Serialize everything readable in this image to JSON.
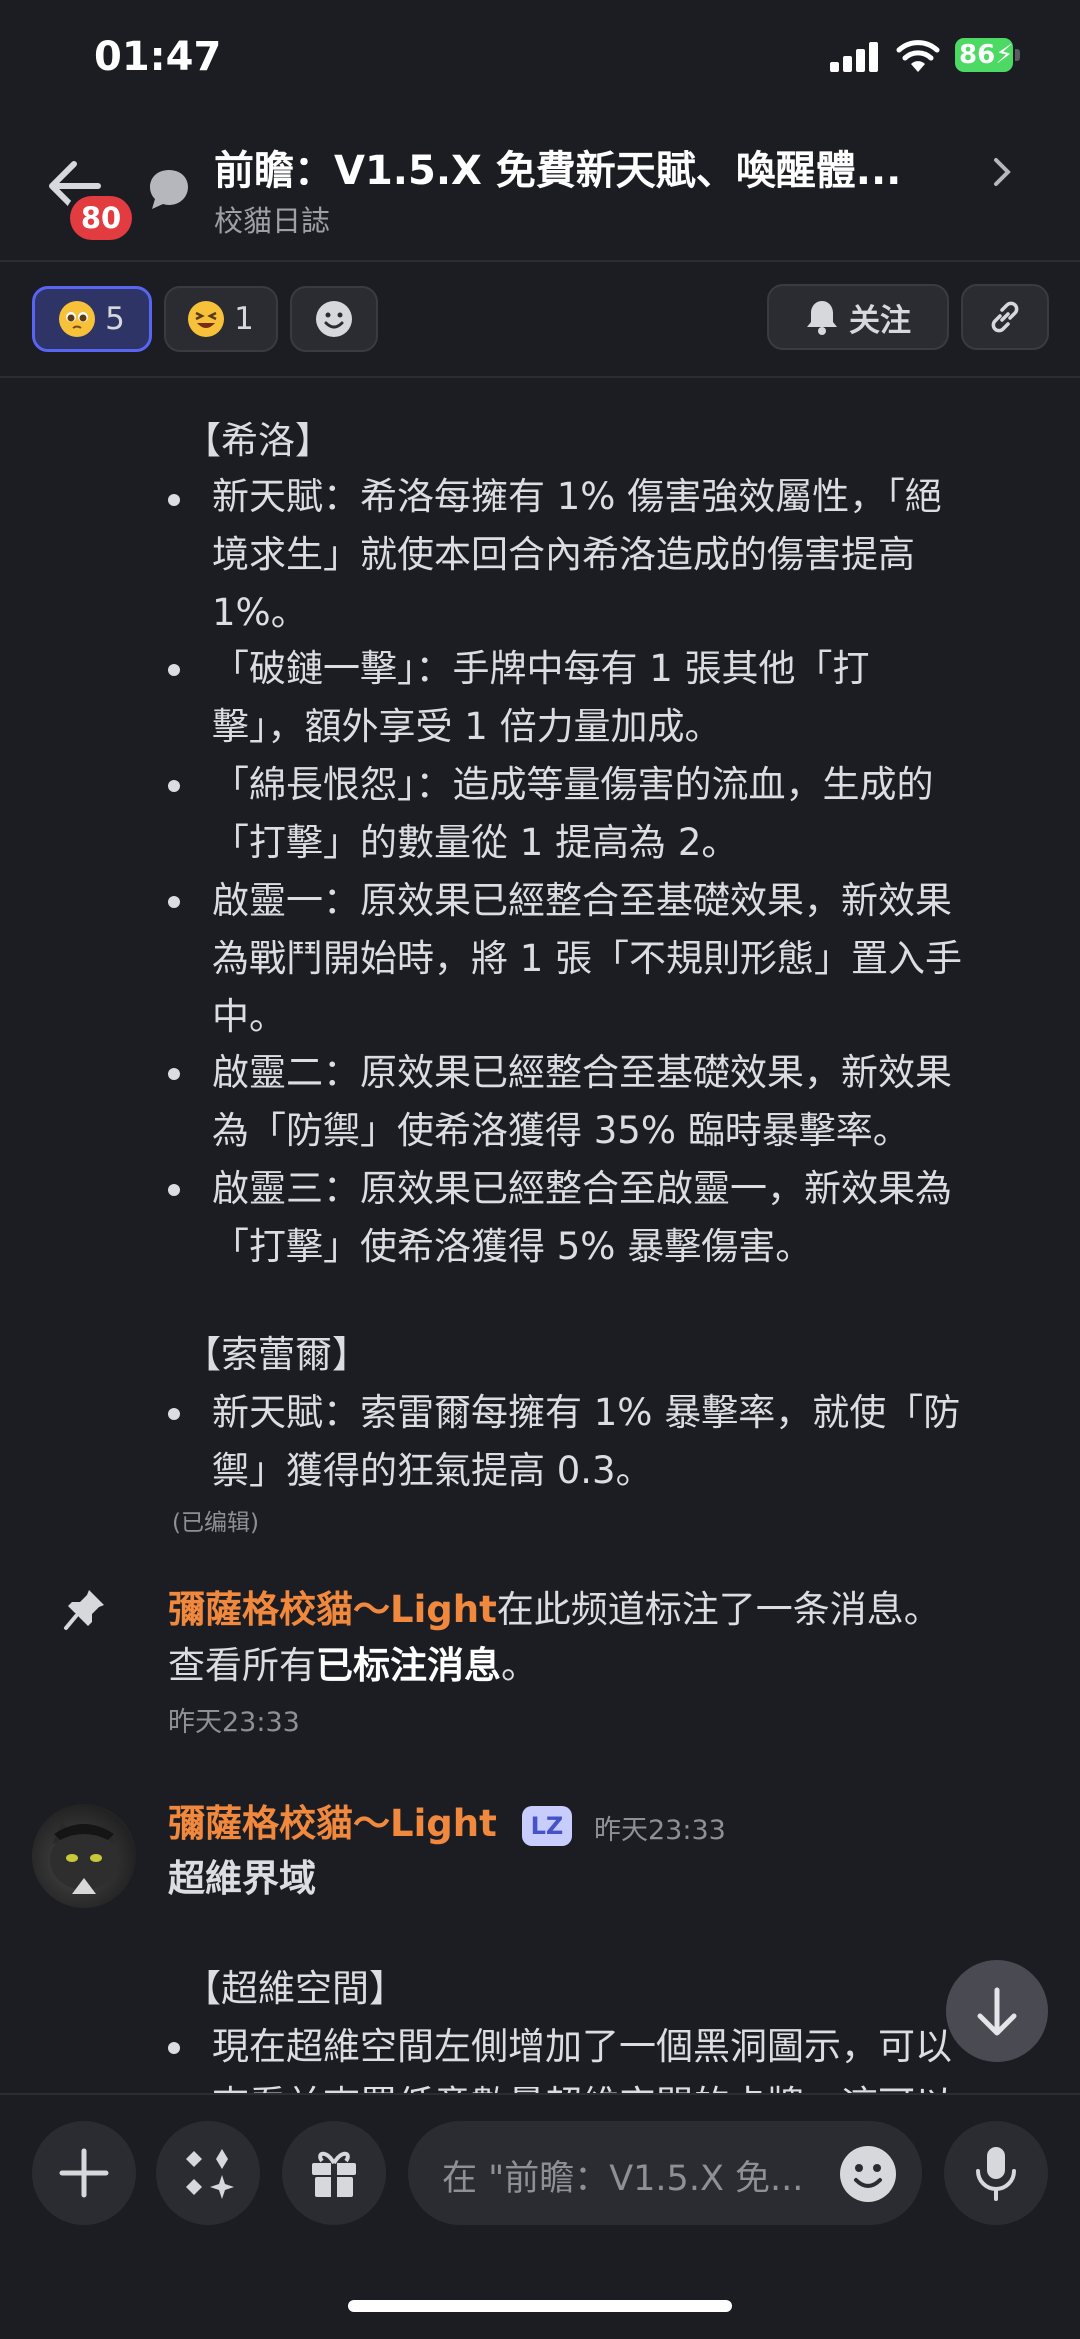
{
  "status": {
    "time": "01:47",
    "battery": "86"
  },
  "header": {
    "back_badge": "80",
    "title": "前瞻：V1.5.X 免費新天賦、喚醒體...",
    "subtitle": "校貓日誌"
  },
  "reactions": [
    {
      "emoji": "pleading-face-emoji",
      "count": "5",
      "active": true
    },
    {
      "emoji": "laughing-face-emoji",
      "count": "1",
      "active": false
    }
  ],
  "actions": {
    "follow_label": "关注"
  },
  "message1": {
    "section1_header": "【希洛】",
    "lines": [
      "新天賦：希洛每擁有 1% 傷害強效屬性，「絕",
      "境求生」就使本回合內希洛造成的傷害提高",
      "1%。",
      "「破鏈一擊」：手牌中每有 1 張其他「打",
      "擊」，額外享受 1 倍力量加成。",
      "「綿長恨怨」：造成等量傷害的流血，生成的",
      "「打擊」的數量從 1 提高為 2。",
      "啟靈一：原效果已經整合至基礎效果，新效果",
      "為戰鬥開始時，將 1 張「不規則形態」置入手",
      "中。",
      "啟靈二：原效果已經整合至基礎效果，新效果",
      "為「防禦」使希洛獲得 35% 臨時暴擊率。",
      "啟靈三：原效果已經整合至啟靈一，新效果為",
      "「打擊」使希洛獲得 5% 暴擊傷害。"
    ],
    "section2_header": "【索蕾爾】",
    "lines2": [
      "新天賦：索雷爾每擁有 1% 暴擊率，就使「防",
      "禦」獲得的狂氣提高 0.3。"
    ],
    "edited": "(已编辑)"
  },
  "pin_notice": {
    "user": "彌薩格校貓～Light",
    "text": "在此频道标注了一条消息。",
    "line2_prefix": "查看所有",
    "line2_link": "已标注消息",
    "line2_suffix": "。",
    "time": "昨天23:33"
  },
  "message2": {
    "user": "彌薩格校貓～Light",
    "tag": "LZ",
    "time": "昨天23:33",
    "title": "超維界域",
    "section_header": "【超維空間】",
    "line1": "現在超維空間左側增加了一個黑洞圖示，可以",
    "line2": "查看並查置低意數量超維空間的卡牌，這可以"
  },
  "composer": {
    "placeholder": "在 \"前瞻：V1.5.X 免..."
  }
}
